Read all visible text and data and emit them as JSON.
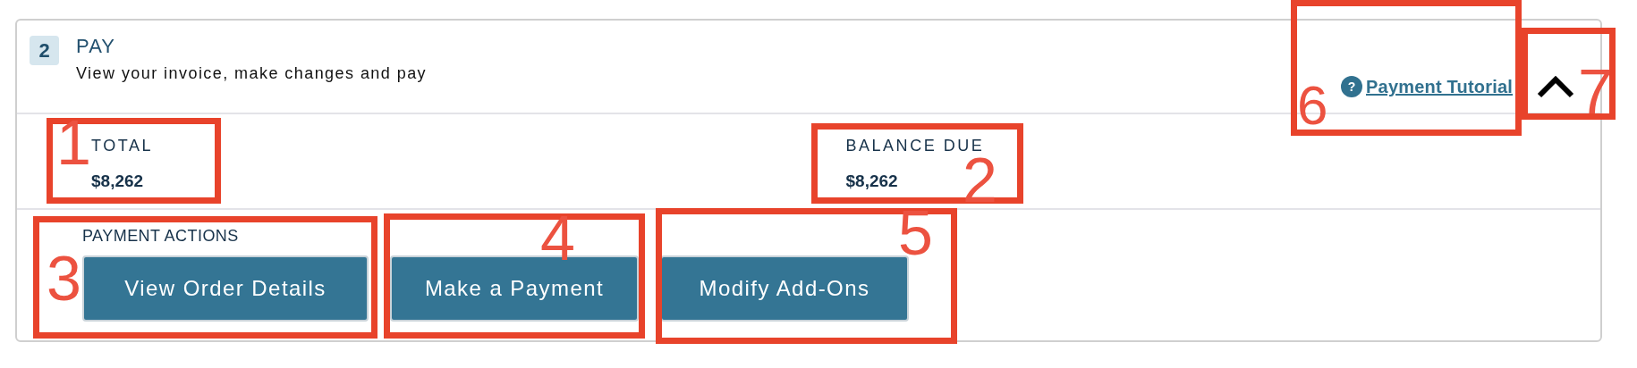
{
  "step": {
    "number": "2",
    "title": "PAY",
    "subtitle": "View your invoice, make changes and pay"
  },
  "tutorial_link": "Payment Tutorial",
  "help_icon": "?",
  "expanded": true,
  "amounts": [
    {
      "label": "TOTAL",
      "value": "$8,262"
    },
    {
      "label": "BALANCE DUE",
      "value": "$8,262"
    }
  ],
  "actions": {
    "label": "PAYMENT ACTIONS",
    "buttons": [
      "View Order Details",
      "Make a Payment",
      "Modify Add-Ons"
    ]
  },
  "annotations": [
    "1",
    "2",
    "3",
    "4",
    "5",
    "6",
    "7"
  ]
}
